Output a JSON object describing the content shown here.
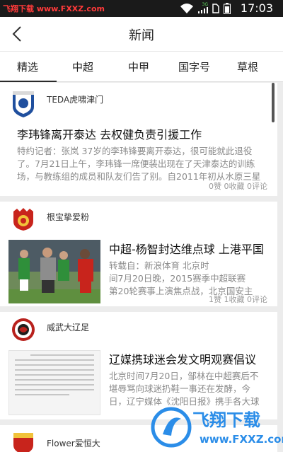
{
  "statusbar": {
    "watermark_name": "飞翔下载",
    "watermark_url": "www.FXXZ.com",
    "network": "3G",
    "time": "17:03"
  },
  "header": {
    "title": "新闻"
  },
  "tabs": [
    {
      "label": "精选",
      "active": true
    },
    {
      "label": "中超",
      "active": false
    },
    {
      "label": "中甲",
      "active": false
    },
    {
      "label": "国字号",
      "active": false
    },
    {
      "label": "草根",
      "active": false
    }
  ],
  "cards": [
    {
      "source": "TEDA虎啸津门",
      "headline": "李玮锋离开泰达 去权健负责引援工作",
      "desc": [
        "特约记者：张岚  37岁的李玮锋要离开泰达，很可能就此退役",
        "了。7月21日上午，李玮锋一席便装出现在了天津泰达的训练",
        "场，与教练组的成员和队友们告了别。自2011年初从水原三星"
      ],
      "stats": "0赞 0收藏 0评论"
    },
    {
      "source": "根宝挚爱粉",
      "headline": "中超-杨智封达维点球 上港平国",
      "desc": [
        "转载自：新浪体育      北京时",
        "间7月20日晚，2015赛季中超联赛",
        "第20轮赛事上演焦点战，北京国安主"
      ],
      "stats": "1赞 1收藏 0评论"
    },
    {
      "source": "威武大辽足",
      "headline": "辽媒携球迷会发文明观赛倡议",
      "desc": [
        "北京时间7月20日，邹林在中超赛后不",
        "堪辱骂向球迷扔鞋一事还在发酵，今",
        "日，辽宁媒体《沈阳日报》携手各大球"
      ],
      "stats": ""
    },
    {
      "source": "Flower爱恒大",
      "headline": "",
      "desc": [],
      "stats": ""
    }
  ],
  "watermark_logo": {
    "text": "飞翔下载",
    "url": "www.FXXZ.com"
  },
  "colors": {
    "accent_text": "#222222",
    "watermark_red": "#ff3a3a",
    "watermark_blue": "#2b8de8"
  }
}
